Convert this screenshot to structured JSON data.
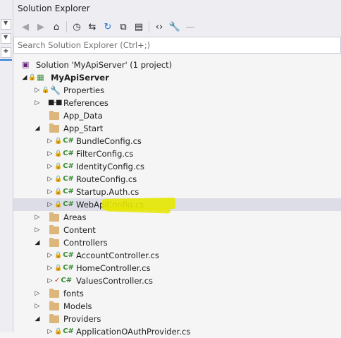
{
  "window": {
    "title": "Solution Explorer"
  },
  "toolbar": {
    "icons": [
      "back-icon",
      "forward-icon",
      "home-icon",
      "history-icon",
      "sync-icon",
      "refresh-icon",
      "collapse-icon",
      "show-all-icon",
      "code-icon",
      "properties-icon",
      "minus-icon"
    ]
  },
  "search": {
    "placeholder": "Search Solution Explorer (Ctrl+;)"
  },
  "tree": {
    "solution": "Solution 'MyApiServer' (1 project)",
    "project": "MyApiServer",
    "items": [
      {
        "label": "Properties"
      },
      {
        "label": "References"
      },
      {
        "label": "App_Data"
      },
      {
        "label": "App_Start"
      },
      {
        "label": "BundleConfig.cs"
      },
      {
        "label": "FilterConfig.cs"
      },
      {
        "label": "IdentityConfig.cs"
      },
      {
        "label": "RouteConfig.cs"
      },
      {
        "label": "Startup.Auth.cs"
      },
      {
        "label": "WebApiConfig.cs"
      },
      {
        "label": "Areas"
      },
      {
        "label": "Content"
      },
      {
        "label": "Controllers"
      },
      {
        "label": "AccountController.cs"
      },
      {
        "label": "HomeController.cs"
      },
      {
        "label": "ValuesController.cs"
      },
      {
        "label": "fonts"
      },
      {
        "label": "Models"
      },
      {
        "label": "Providers"
      },
      {
        "label": "ApplicationOAuthProvider.cs"
      }
    ]
  },
  "colors": {
    "highlight": "#e6e800",
    "selected_row": "#dddde8",
    "csharp": "#388a34",
    "folder": "#dcb67a"
  }
}
